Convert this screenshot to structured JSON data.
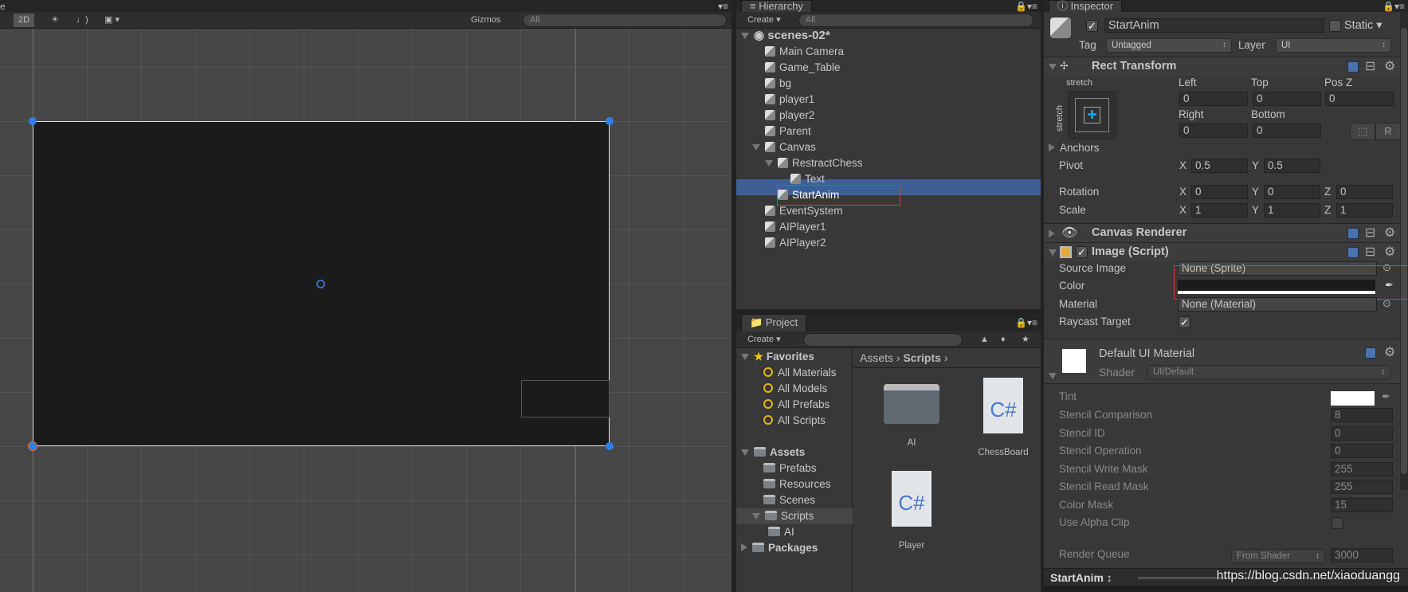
{
  "scene": {
    "tab_label": "e",
    "toolbar": {
      "mode_2d": "2D",
      "gizmos": "Gizmos",
      "search_placeholder": "All"
    },
    "icons": [
      "light-icon",
      "audio-icon",
      "image-effects-icon"
    ]
  },
  "hierarchy": {
    "tab_label": "Hierarchy",
    "create": "Create",
    "search_placeholder": "All",
    "scene_name": "scenes-02*",
    "items": [
      {
        "label": "Main Camera"
      },
      {
        "label": "Game_Table"
      },
      {
        "label": "bg"
      },
      {
        "label": "player1"
      },
      {
        "label": "player2"
      },
      {
        "label": "Parent"
      },
      {
        "label": "Canvas",
        "expanded": true
      },
      {
        "label": "RestractChess",
        "expanded": true
      },
      {
        "label": "Text"
      },
      {
        "label": "StartAnim",
        "selected": true
      },
      {
        "label": "EventSystem"
      },
      {
        "label": "AIPlayer1"
      },
      {
        "label": "AIPlayer2"
      }
    ]
  },
  "project": {
    "tab_label": "Project",
    "create": "Create",
    "search_placeholder": "",
    "favorites_label": "Favorites",
    "favorites": [
      "All Materials",
      "All Models",
      "All Prefabs",
      "All Scripts"
    ],
    "assets_label": "Assets",
    "asset_folders": [
      "Prefabs",
      "Resources",
      "Scenes",
      "Scripts"
    ],
    "scripts_sub": "AI",
    "packages_label": "Packages",
    "breadcrumb": [
      "Assets",
      "Scripts"
    ],
    "files": [
      {
        "name": "AI",
        "type": "folder"
      },
      {
        "name": "ChessBoard",
        "type": "csharp"
      },
      {
        "name": "Player",
        "type": "csharp"
      }
    ],
    "csharp_glyph": "C#"
  },
  "inspector": {
    "tab_label": "Inspector",
    "object_name": "StartAnim",
    "active": true,
    "static_label": "Static",
    "static": false,
    "tag_label": "Tag",
    "tag": "Untagged",
    "layer_label": "Layer",
    "layer": "UI",
    "rect_transform": {
      "title": "Rect Transform",
      "anchor_preset": "stretch",
      "left_label": "Left",
      "top_label": "Top",
      "posz_label": "Pos Z",
      "left": "0",
      "top": "0",
      "posz": "0",
      "right_label": "Right",
      "bottom_label": "Bottom",
      "right": "0",
      "bottom": "0",
      "r_button": "R",
      "anchors_label": "Anchors",
      "pivot_label": "Pivot",
      "pivot_x": "0.5",
      "pivot_y": "0.5",
      "rotation_label": "Rotation",
      "rot_x": "0",
      "rot_y": "0",
      "rot_z": "0",
      "scale_label": "Scale",
      "scale_x": "1",
      "scale_y": "1",
      "scale_z": "1",
      "x": "X",
      "y": "Y",
      "z": "Z"
    },
    "canvas_renderer": {
      "title": "Canvas Renderer"
    },
    "image": {
      "title": "Image (Script)",
      "enabled": true,
      "source_image_label": "Source Image",
      "source_image": "None (Sprite)",
      "color_label": "Color",
      "color": "#1b1b1b",
      "material_label": "Material",
      "material": "None (Material)",
      "raycast_label": "Raycast Target",
      "raycast": true
    },
    "material": {
      "title": "Default UI Material",
      "shader_label": "Shader",
      "shader": "UI/Default",
      "tint_label": "Tint",
      "tint": "#ffffff",
      "props": [
        {
          "label": "Stencil Comparison",
          "value": "8"
        },
        {
          "label": "Stencil ID",
          "value": "0"
        },
        {
          "label": "Stencil Operation",
          "value": "0"
        },
        {
          "label": "Stencil Write Mask",
          "value": "255"
        },
        {
          "label": "Stencil Read Mask",
          "value": "255"
        },
        {
          "label": "Color Mask",
          "value": "15"
        }
      ],
      "alpha_clip_label": "Use Alpha Clip",
      "alpha_clip": false,
      "render_queue_label": "Render Queue",
      "render_queue_mode": "From Shader",
      "render_queue": "3000"
    },
    "footer_object": "StartAnim"
  },
  "watermark": "https://blog.csdn.net/xiaoduangg",
  "colors": {
    "selection": "#3e5f96",
    "highlight_box": "#e03a3a",
    "panel": "#383838",
    "scene_bg": "#474747"
  }
}
